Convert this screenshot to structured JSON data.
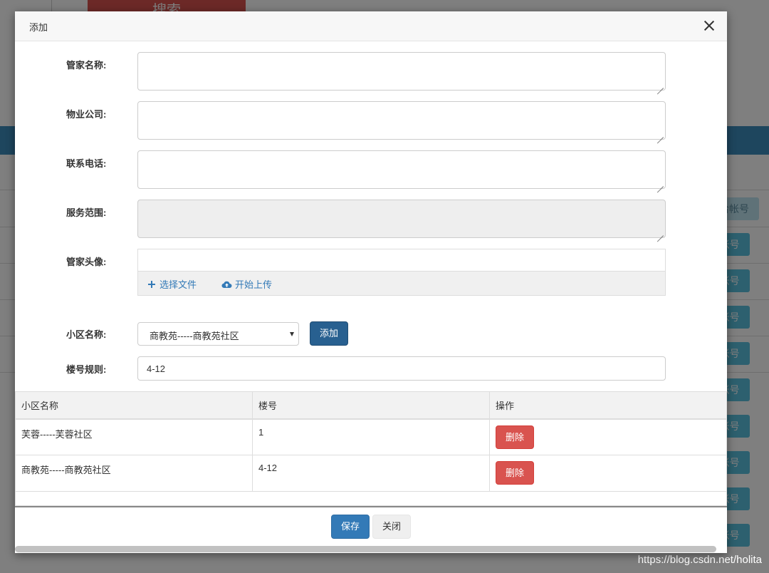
{
  "background": {
    "search_label": "搜索",
    "account_label": "给帐号",
    "row_btn_label": "帐号"
  },
  "watermark": "https://blog.csdn.net/holita",
  "modal": {
    "title": "添加",
    "fields": {
      "butler_name": {
        "label": "管家名称:",
        "value": ""
      },
      "property_company": {
        "label": "物业公司:",
        "value": ""
      },
      "contact_phone": {
        "label": "联系电话:",
        "value": ""
      },
      "service_scope": {
        "label": "服务范围:",
        "value": ""
      },
      "avatar": {
        "label": "管家头像:"
      },
      "community_name": {
        "label": "小区名称:",
        "selected": "商教苑-----商教苑社区"
      },
      "building_rule": {
        "label": "楼号规则:",
        "value": "4-12"
      }
    },
    "uploader": {
      "choose_label": "选择文件",
      "upload_label": "开始上传"
    },
    "add_button": "添加",
    "table": {
      "headers": [
        "小区名称",
        "楼号",
        "操作"
      ],
      "rows": [
        {
          "community": "芙蓉-----芙蓉社区",
          "building": "1",
          "action": "删除"
        },
        {
          "community": "商教苑-----商教苑社区",
          "building": "4-12",
          "action": "删除"
        }
      ]
    },
    "footer": {
      "save": "保存",
      "close": "关闭"
    }
  }
}
